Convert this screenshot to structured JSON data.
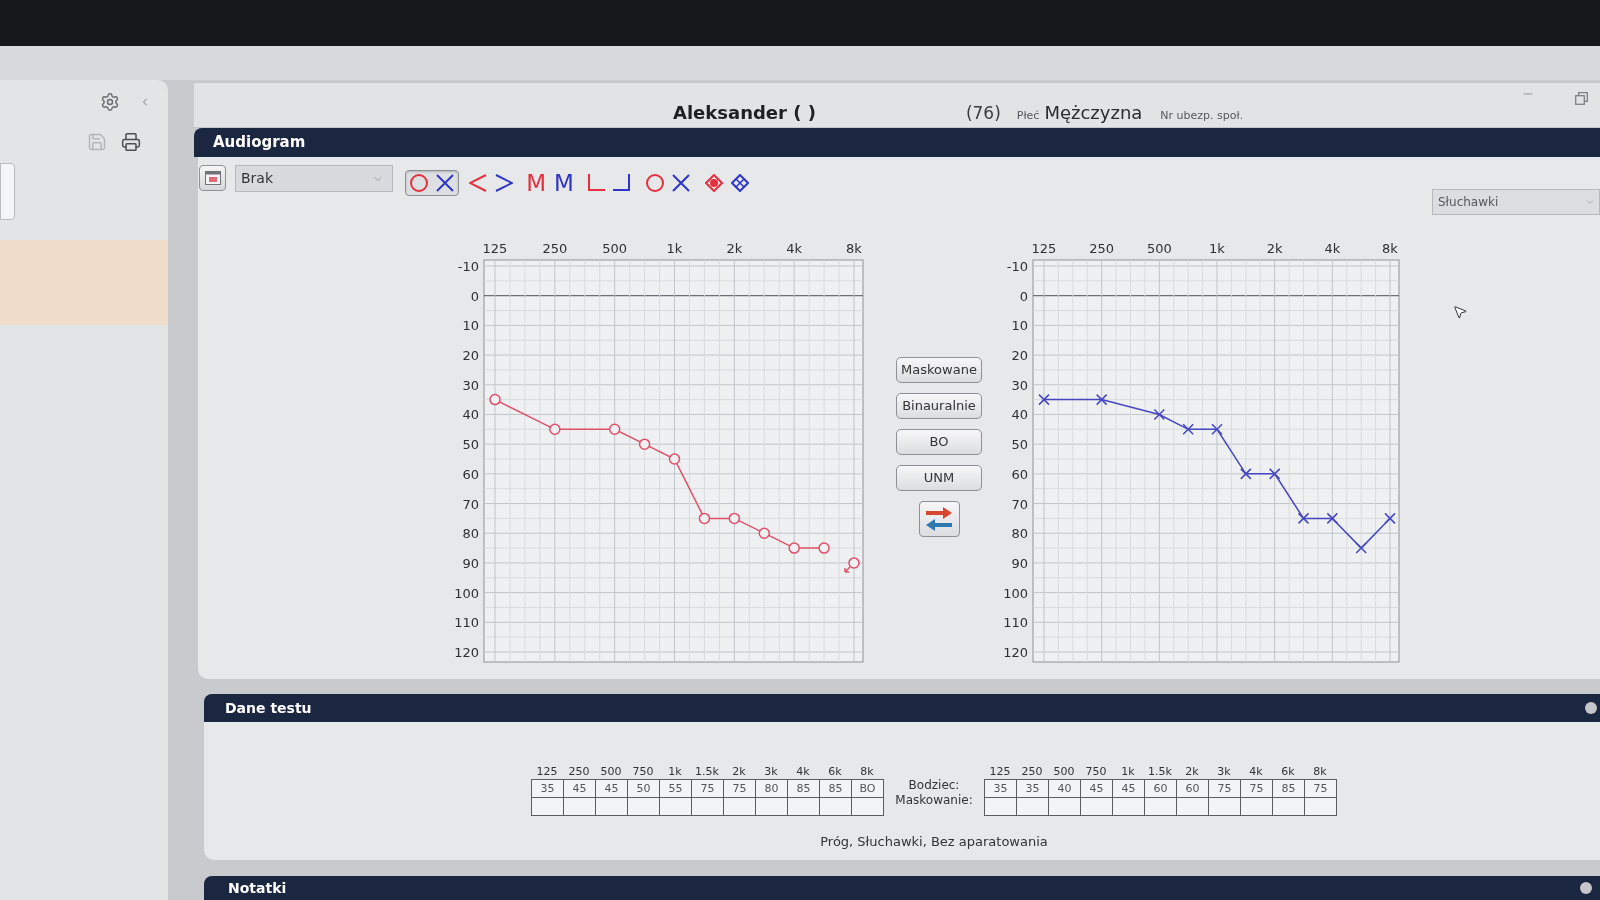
{
  "sidebar": {
    "save_button": {
      "disabled": true
    },
    "print_button": {
      "disabled": false
    },
    "items": [
      {
        "selected": true
      }
    ]
  },
  "patient": {
    "name": "Aleksander ( )",
    "age": "(76)",
    "sex_label": "Płeć",
    "sex": "Mężczyzna",
    "insurance_label": "Nr ubezp. społ."
  },
  "audiogram": {
    "title": "Audiogram",
    "preset": {
      "value": "Brak"
    },
    "marker_buttons": [
      {
        "selected": true,
        "markers": [
          {
            "kind": "circle",
            "color": "#e4303f"
          },
          {
            "kind": "cross",
            "color": "#2f35c8"
          }
        ]
      },
      {
        "selected": false,
        "markers": [
          {
            "kind": "angle-left",
            "color": "#e4303f"
          },
          {
            "kind": "angle-right",
            "color": "#2f35c8"
          }
        ]
      },
      {
        "selected": false,
        "markers": [
          {
            "kind": "glyph",
            "text": "M",
            "color": "#e4303f"
          },
          {
            "kind": "glyph",
            "text": "M",
            "color": "#2f35c8"
          }
        ]
      },
      {
        "selected": false,
        "markers": [
          {
            "kind": "bracket-left",
            "color": "#e4303f"
          },
          {
            "kind": "bracket-right",
            "color": "#2f35c8"
          }
        ]
      },
      {
        "selected": false,
        "markers": [
          {
            "kind": "circle",
            "color": "#e4303f"
          },
          {
            "kind": "cross",
            "color": "#2f35c8"
          }
        ]
      },
      {
        "selected": false,
        "markers": [
          {
            "kind": "diamond-dot",
            "color": "#e4303f"
          },
          {
            "kind": "diamond-cross",
            "color": "#2f35c8"
          }
        ]
      }
    ],
    "transducer": {
      "value": "Słuchawki"
    },
    "left_chart": {
      "chart_data": {
        "type": "line",
        "categories": [
          "125",
          null,
          "250",
          null,
          "500",
          null,
          "1k",
          null,
          "2k",
          null,
          "4k",
          null,
          "8k"
        ],
        "ylim": [
          120,
          -10
        ],
        "yticks": [
          -10,
          0,
          10,
          20,
          30,
          40,
          50,
          60,
          70,
          80,
          90,
          100,
          110,
          120
        ],
        "grid": true,
        "series": [
          {
            "color": "#e0506a",
            "marker": "circle",
            "values": [
              35,
              null,
              45,
              null,
              45,
              50,
              55,
              75,
              75,
              80,
              85,
              85,
              null
            ]
          },
          {
            "color": "#e0506a",
            "marker": "circle",
            "values": [
              null,
              null,
              null,
              null,
              null,
              null,
              null,
              null,
              null,
              null,
              null,
              null,
              90
            ]
          }
        ]
      }
    },
    "side_buttons": [
      {
        "label": "Maskowane"
      },
      {
        "label": "Binauralnie"
      },
      {
        "label": "BO"
      },
      {
        "label": "UNM"
      }
    ],
    "right_chart": {
      "chart_data": {
        "type": "line",
        "categories": [
          "125",
          null,
          "250",
          null,
          "500",
          null,
          "1k",
          null,
          "2k",
          null,
          "4k",
          null,
          "8k"
        ],
        "ylim": [
          120,
          -10
        ],
        "yticks": [
          -10,
          0,
          10,
          20,
          30,
          40,
          50,
          60,
          70,
          80,
          90,
          100,
          110,
          120
        ],
        "grid": true,
        "series": [
          {
            "color": "#4646c0",
            "marker": "cross",
            "values": [
              35,
              null,
              35,
              null,
              40,
              45,
              45,
              60,
              60,
              75,
              75,
              85,
              75
            ]
          }
        ]
      }
    }
  },
  "test_data": {
    "title": "Dane testu",
    "left_table": {
      "columns": [
        "125",
        "250",
        "500",
        "750",
        "1k",
        "1.5k",
        "2k",
        "3k",
        "4k",
        "6k",
        "8k"
      ],
      "stimulus": [
        "35",
        "45",
        "45",
        "50",
        "55",
        "75",
        "75",
        "80",
        "85",
        "85",
        "BO"
      ]
    },
    "row_labels": [
      "Bodziec:",
      "Maskowanie:"
    ],
    "right_table": {
      "columns": [
        "125",
        "250",
        "500",
        "750",
        "1k",
        "1.5k",
        "2k",
        "3k",
        "4k",
        "6k",
        "8k"
      ],
      "stimulus": [
        "35",
        "35",
        "40",
        "45",
        "45",
        "60",
        "60",
        "75",
        "75",
        "85",
        "75"
      ]
    },
    "caption": "Próg, Słuchawki, Bez aparatowania"
  },
  "notes": {
    "title": "Notatki"
  }
}
